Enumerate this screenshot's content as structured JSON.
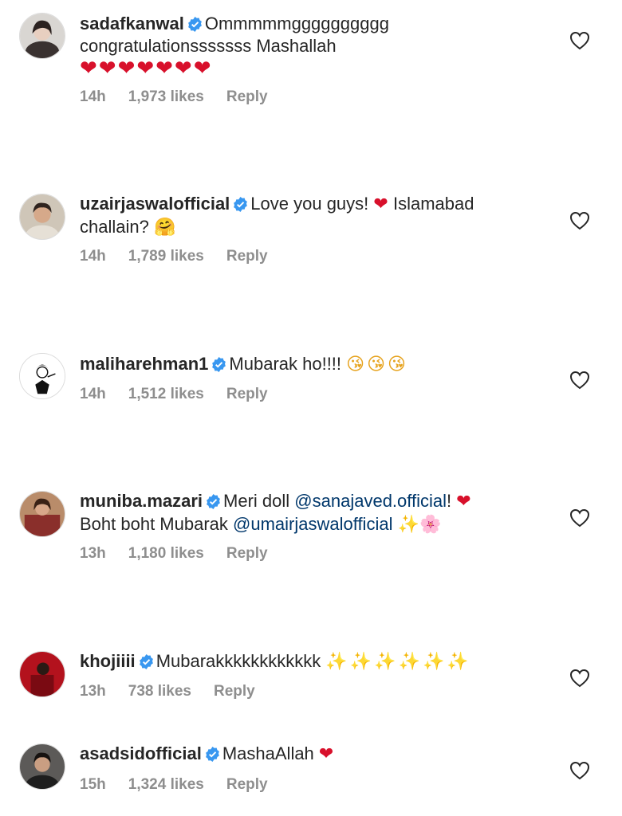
{
  "comments": [
    {
      "username": "sadafkanwal",
      "text_parts": [
        "Ommmmmgggggggggg congratulationsssssss Mashallah"
      ],
      "emoji": "❤❤❤❤❤❤❤",
      "time": "14h",
      "likes": "1,973 likes",
      "reply": "Reply"
    },
    {
      "username": "uzairjaswalofficial",
      "text_parts": [
        "Love you guys! ",
        " Islamabad challain? "
      ],
      "emoji_a": "❤",
      "emoji_b": "🤗",
      "time": "14h",
      "likes": "1,789 likes",
      "reply": "Reply"
    },
    {
      "username": "maliharehman1",
      "text_parts": [
        "Mubarak ho!!!! "
      ],
      "emoji": "😘😘😘",
      "time": "14h",
      "likes": "1,512 likes",
      "reply": "Reply"
    },
    {
      "username": "muniba.mazari",
      "text_parts": [
        "Meri doll ",
        "@sanajaved.official",
        "! ",
        "Boht boht Mubarak ",
        "@umairjaswalofficial",
        " "
      ],
      "emoji_a": "❤",
      "emoji_b": "✨🌸",
      "time": "13h",
      "likes": "1,180 likes",
      "reply": "Reply"
    },
    {
      "username": "khojiiii",
      "text_parts": [
        "Mubarakkkkkkkkkkkk "
      ],
      "emoji": "✨✨✨✨✨✨",
      "time": "13h",
      "likes": "738 likes",
      "reply": "Reply"
    },
    {
      "username": "asadsidofficial",
      "text_parts": [
        "MashaAllah "
      ],
      "emoji": "❤",
      "time": "15h",
      "likes": "1,324 likes",
      "reply": "Reply"
    }
  ],
  "icons": {
    "verified": "verified-badge-icon",
    "like": "heart-outline-icon"
  },
  "colors": {
    "verified": "#3897f0",
    "mention": "#00376b",
    "meta": "#8e8e8e"
  }
}
